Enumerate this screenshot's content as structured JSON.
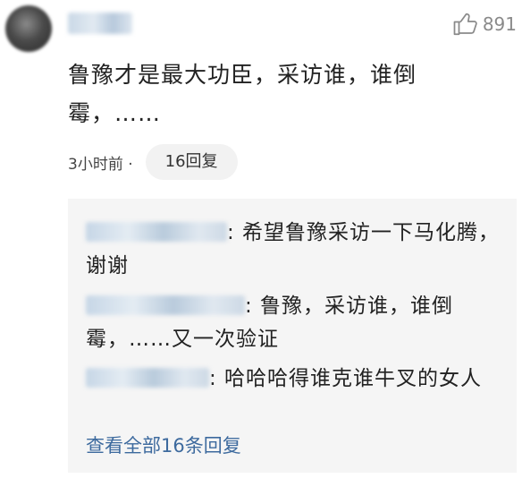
{
  "comment": {
    "likes": "891",
    "text": "鲁豫才是最大功臣，采访谁，谁倒霉，……",
    "time": "3小时前 ·",
    "reply_count_label": "16回复"
  },
  "replies": [
    {
      "text": ": 希望鲁豫采访一下马化腾，谢谢"
    },
    {
      "text": ": 鲁豫，采访谁，谁倒霉，……又一次验证"
    },
    {
      "text": ": 哈哈哈得谁克谁牛叉的女人"
    }
  ],
  "view_all_label": "查看全部16条回复",
  "colors": {
    "link": "#3d6a9e",
    "reply_bg": "#f5f5f5",
    "pill_bg": "#f2f2f2",
    "muted": "#8a8a8a"
  }
}
